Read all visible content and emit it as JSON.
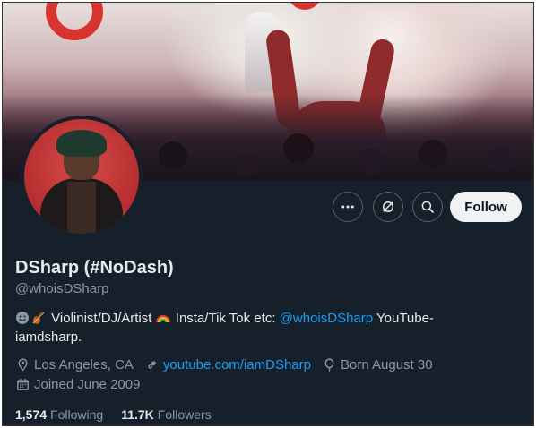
{
  "profile": {
    "name": "DSharp (#NoDash)",
    "handle": "@whoisDSharp",
    "bio": {
      "text1": "Violinist/DJ/Artist",
      "text2": "Insta/Tik Tok etc:",
      "mention": "@whoisDSharp",
      "text3": "YouTube-",
      "text4": "iamdsharp."
    },
    "location": "Los Angeles, CA",
    "website": "youtube.com/iamDSharp",
    "birthday": "Born August 30",
    "joined": "Joined June 2009",
    "following_count": "1,574",
    "following_label": "Following",
    "followers_count": "11.7K",
    "followers_label": "Followers"
  },
  "actions": {
    "more": "more-icon",
    "grok": "grok-icon",
    "search": "search-icon",
    "follow_label": "Follow"
  },
  "colors": {
    "background": "#15202b",
    "text": "#e7e9ea",
    "secondary": "#8b98a5",
    "link": "#1d9bf0",
    "follow_button": "#eff3f4"
  }
}
